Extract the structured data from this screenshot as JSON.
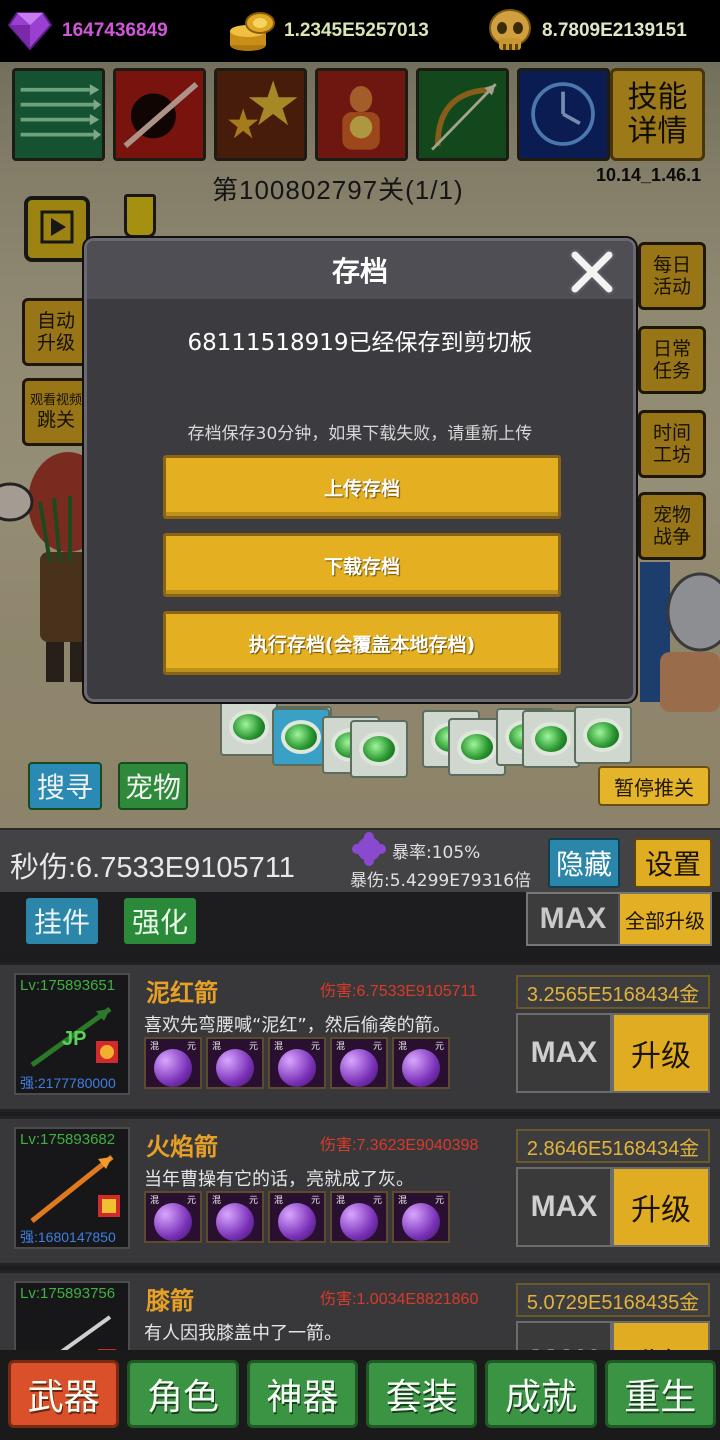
{
  "currencies": {
    "gems": "1647436849",
    "coins": "1.2345E5257013",
    "skulls": "8.7809E2139151"
  },
  "skills": {
    "items": [
      "green-arrows-skill-icon",
      "red-slash-skill-icon",
      "stars-skill-icon",
      "fire-body-skill-icon",
      "bow-skill-icon",
      "blue-clock-skill-icon"
    ],
    "detail_label": "技能\n详情"
  },
  "version": "10.14_1.46.1",
  "stage": "第100802797关(1/1)",
  "side_left": {
    "auto_upgrade": "自动\n升级",
    "watch_video": "观看视频",
    "skip_level": "跳关"
  },
  "side_right": {
    "daily_event": "每日\n活动",
    "daily_task": "日常\n任务",
    "time_workshop": "时间\n工坊",
    "pet_war": "宠物\n战争"
  },
  "scene_buttons": {
    "search": "搜寻",
    "pet": "宠物",
    "pause": "暂停推关"
  },
  "modal": {
    "title": "存档",
    "message": "68111518919已经保存到剪切板",
    "note": "存档保存30分钟，如果下载失败，请重新上传",
    "upload": "上传存档",
    "download": "下载存档",
    "execute": "执行存档(会覆盖本地存档)"
  },
  "stats": {
    "dps": "秒伤:6.7533E9105711",
    "crit_rate": "暴率:105%",
    "crit_damage": "暴伤:5.4299E79316倍",
    "hide": "隐藏",
    "settings": "设置"
  },
  "tabs": {
    "hang": "挂件",
    "enhance": "强化",
    "max": "MAX",
    "upgrade_all": "全部升级"
  },
  "weapons": [
    {
      "level": "Lv:175893651",
      "strength": "强:2177780000",
      "name": "泥红箭",
      "damage": "伤害:6.7533E9105711",
      "desc": "喜欢先弯腰喊“泥红”，然后偷袭的箭。",
      "cost": "3.2565E5168434金",
      "max": "MAX",
      "upgrade": "升级"
    },
    {
      "level": "Lv:175893682",
      "strength": "强:1680147850",
      "name": "火焰箭",
      "damage": "伤害:7.3623E9040398",
      "desc": "当年曹操有它的话，亮就成了灰。",
      "cost": "2.8646E5168434金",
      "max": "MAX",
      "upgrade": "升级"
    },
    {
      "level": "Lv:175893756",
      "strength": "",
      "name": "膝箭",
      "damage": "伤害:1.0034E8821860",
      "desc": "有人因我膝盖中了一箭。",
      "cost": "5.0729E5168435金",
      "max": "MAX",
      "upgrade": "升级"
    }
  ],
  "orb_labels": [
    "混",
    "元"
  ],
  "bottom_nav": [
    "武器",
    "角色",
    "神器",
    "套装",
    "成就",
    "重生"
  ],
  "colors": {
    "gold_button": "#e4b022",
    "green_nav": "#3b9444",
    "active_nav": "#d9502b",
    "weapon_name": "#e6a028",
    "damage_red": "#d83a2a"
  }
}
